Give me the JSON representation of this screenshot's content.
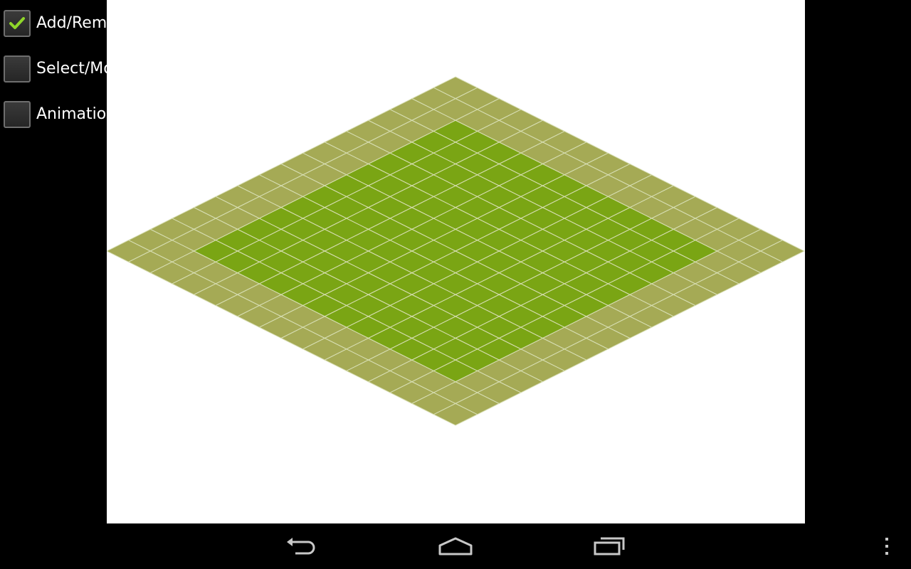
{
  "modes": [
    {
      "label": "Add/Remove",
      "checked": true
    },
    {
      "label": "Select/Move",
      "checked": false
    },
    {
      "label": "Animation",
      "checked": false
    }
  ],
  "board": {
    "grid_size": 16,
    "border_tiles": 2,
    "colors": {
      "inner_grass": "#7aa514",
      "border_grass": "#a5aa55",
      "grid_line": "#d8dfb5",
      "background": "#ffffff"
    }
  },
  "nav": {
    "icons": [
      "back-icon",
      "home-icon",
      "recent-apps-icon",
      "overflow-menu-icon"
    ],
    "icon_color": "#c8c8c8",
    "check_color": "#8fd62a"
  }
}
